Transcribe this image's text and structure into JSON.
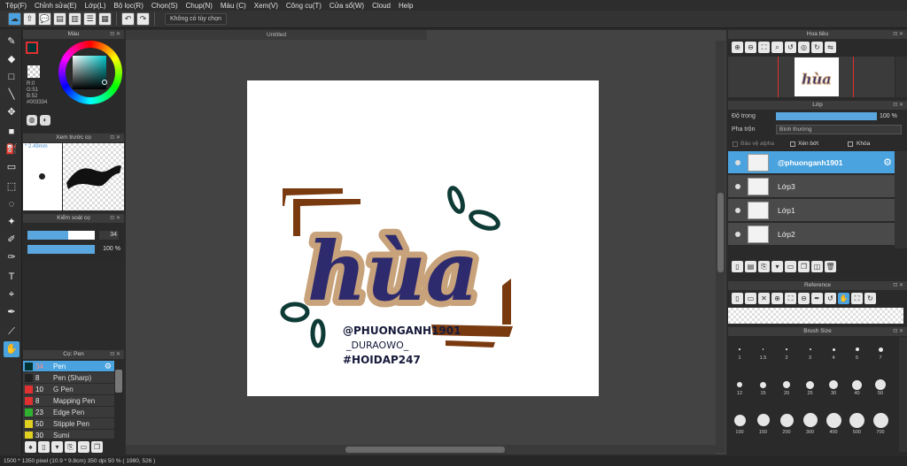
{
  "menu": [
    "Tệp(F)",
    "Chỉnh sửa(E)",
    "Lớp(L)",
    "Bộ lọc(R)",
    "Chọn(S)",
    "Chụp(N)",
    "Màu (C)",
    "Xem(V)",
    "Công cụ(T)",
    "Cửa sổ(W)",
    "Cloud",
    "Help"
  ],
  "toolbar": {
    "no_option": "Không có tùy chọn"
  },
  "color_panel": {
    "title": "Màu",
    "r": "R:0",
    "g": "G:51",
    "b": "B:52",
    "hex": "#003334",
    "main_color": "#003334"
  },
  "preview_panel": {
    "title": "Xem trước cọ",
    "size": "* 2.49mm"
  },
  "brush_control": {
    "title": "Kiểm soát cọ",
    "size": "34",
    "opacity": "100 %"
  },
  "brush_list": {
    "title": "Cọ: Pen",
    "items": [
      {
        "size": "34",
        "name": "Pen",
        "color": "#003334"
      },
      {
        "size": "8",
        "name": "Pen (Sharp)",
        "color": "#222222"
      },
      {
        "size": "10",
        "name": "G Pen",
        "color": "#e03030"
      },
      {
        "size": "8",
        "name": "Mapping Pen",
        "color": "#e03030"
      },
      {
        "size": "23",
        "name": "Edge Pen",
        "color": "#30b030"
      },
      {
        "size": "50",
        "name": "Stipple Pen",
        "color": "#e0d020"
      },
      {
        "size": "30",
        "name": "Sumi",
        "color": "#e0d020"
      }
    ]
  },
  "document": {
    "title": "Untitled"
  },
  "artwork": {
    "word": "hùa",
    "line1": "@PHUONGANH1901",
    "line2": "_DURAOWO_",
    "line3": "#HOIDAP247"
  },
  "navigator": {
    "title": "Hoa tiêu"
  },
  "layers": {
    "title": "Lớp",
    "opacity_label": "Độ trong",
    "opacity_value": "100 %",
    "blend_label": "Pha trộn",
    "blend_value": "Bình thường",
    "protect_alpha": "Bảo vệ alpha",
    "clipping": "Xén bớt",
    "lock": "Khóa",
    "items": [
      "@phuonganh1901",
      "Lớp3",
      "Lớp1",
      "Lớp2"
    ]
  },
  "reference": {
    "title": "Reference"
  },
  "brush_size": {
    "title": "Brush Size",
    "labels": [
      "1",
      "1.5",
      "2",
      "3",
      "4",
      "5",
      "7",
      "12",
      "15",
      "20",
      "25",
      "30",
      "40",
      "50",
      "100",
      "150",
      "200",
      "300",
      "400",
      "500",
      "700"
    ]
  },
  "status": "1500 * 1350 pixel  (10.9 * 9.8cm)  350 dpi  50 %  ( 1980, 526 )"
}
